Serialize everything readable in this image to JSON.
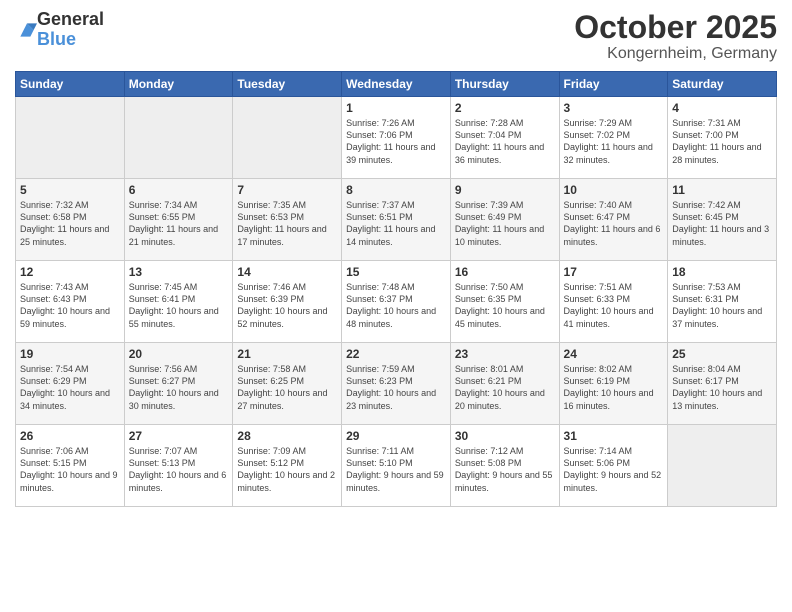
{
  "header": {
    "logo_general": "General",
    "logo_blue": "Blue",
    "month_title": "October 2025",
    "location": "Kongernheim, Germany"
  },
  "weekdays": [
    "Sunday",
    "Monday",
    "Tuesday",
    "Wednesday",
    "Thursday",
    "Friday",
    "Saturday"
  ],
  "rows": [
    [
      {
        "day": "",
        "empty": true
      },
      {
        "day": "",
        "empty": true
      },
      {
        "day": "",
        "empty": true
      },
      {
        "day": "1",
        "sunrise": "7:26 AM",
        "sunset": "7:06 PM",
        "daylight": "11 hours and 39 minutes."
      },
      {
        "day": "2",
        "sunrise": "7:28 AM",
        "sunset": "7:04 PM",
        "daylight": "11 hours and 36 minutes."
      },
      {
        "day": "3",
        "sunrise": "7:29 AM",
        "sunset": "7:02 PM",
        "daylight": "11 hours and 32 minutes."
      },
      {
        "day": "4",
        "sunrise": "7:31 AM",
        "sunset": "7:00 PM",
        "daylight": "11 hours and 28 minutes."
      }
    ],
    [
      {
        "day": "5",
        "sunrise": "7:32 AM",
        "sunset": "6:58 PM",
        "daylight": "11 hours and 25 minutes."
      },
      {
        "day": "6",
        "sunrise": "7:34 AM",
        "sunset": "6:55 PM",
        "daylight": "11 hours and 21 minutes."
      },
      {
        "day": "7",
        "sunrise": "7:35 AM",
        "sunset": "6:53 PM",
        "daylight": "11 hours and 17 minutes."
      },
      {
        "day": "8",
        "sunrise": "7:37 AM",
        "sunset": "6:51 PM",
        "daylight": "11 hours and 14 minutes."
      },
      {
        "day": "9",
        "sunrise": "7:39 AM",
        "sunset": "6:49 PM",
        "daylight": "11 hours and 10 minutes."
      },
      {
        "day": "10",
        "sunrise": "7:40 AM",
        "sunset": "6:47 PM",
        "daylight": "11 hours and 6 minutes."
      },
      {
        "day": "11",
        "sunrise": "7:42 AM",
        "sunset": "6:45 PM",
        "daylight": "11 hours and 3 minutes."
      }
    ],
    [
      {
        "day": "12",
        "sunrise": "7:43 AM",
        "sunset": "6:43 PM",
        "daylight": "10 hours and 59 minutes."
      },
      {
        "day": "13",
        "sunrise": "7:45 AM",
        "sunset": "6:41 PM",
        "daylight": "10 hours and 55 minutes."
      },
      {
        "day": "14",
        "sunrise": "7:46 AM",
        "sunset": "6:39 PM",
        "daylight": "10 hours and 52 minutes."
      },
      {
        "day": "15",
        "sunrise": "7:48 AM",
        "sunset": "6:37 PM",
        "daylight": "10 hours and 48 minutes."
      },
      {
        "day": "16",
        "sunrise": "7:50 AM",
        "sunset": "6:35 PM",
        "daylight": "10 hours and 45 minutes."
      },
      {
        "day": "17",
        "sunrise": "7:51 AM",
        "sunset": "6:33 PM",
        "daylight": "10 hours and 41 minutes."
      },
      {
        "day": "18",
        "sunrise": "7:53 AM",
        "sunset": "6:31 PM",
        "daylight": "10 hours and 37 minutes."
      }
    ],
    [
      {
        "day": "19",
        "sunrise": "7:54 AM",
        "sunset": "6:29 PM",
        "daylight": "10 hours and 34 minutes."
      },
      {
        "day": "20",
        "sunrise": "7:56 AM",
        "sunset": "6:27 PM",
        "daylight": "10 hours and 30 minutes."
      },
      {
        "day": "21",
        "sunrise": "7:58 AM",
        "sunset": "6:25 PM",
        "daylight": "10 hours and 27 minutes."
      },
      {
        "day": "22",
        "sunrise": "7:59 AM",
        "sunset": "6:23 PM",
        "daylight": "10 hours and 23 minutes."
      },
      {
        "day": "23",
        "sunrise": "8:01 AM",
        "sunset": "6:21 PM",
        "daylight": "10 hours and 20 minutes."
      },
      {
        "day": "24",
        "sunrise": "8:02 AM",
        "sunset": "6:19 PM",
        "daylight": "10 hours and 16 minutes."
      },
      {
        "day": "25",
        "sunrise": "8:04 AM",
        "sunset": "6:17 PM",
        "daylight": "10 hours and 13 minutes."
      }
    ],
    [
      {
        "day": "26",
        "sunrise": "7:06 AM",
        "sunset": "5:15 PM",
        "daylight": "10 hours and 9 minutes."
      },
      {
        "day": "27",
        "sunrise": "7:07 AM",
        "sunset": "5:13 PM",
        "daylight": "10 hours and 6 minutes."
      },
      {
        "day": "28",
        "sunrise": "7:09 AM",
        "sunset": "5:12 PM",
        "daylight": "10 hours and 2 minutes."
      },
      {
        "day": "29",
        "sunrise": "7:11 AM",
        "sunset": "5:10 PM",
        "daylight": "9 hours and 59 minutes."
      },
      {
        "day": "30",
        "sunrise": "7:12 AM",
        "sunset": "5:08 PM",
        "daylight": "9 hours and 55 minutes."
      },
      {
        "day": "31",
        "sunrise": "7:14 AM",
        "sunset": "5:06 PM",
        "daylight": "9 hours and 52 minutes."
      },
      {
        "day": "",
        "empty": true
      }
    ]
  ],
  "labels": {
    "sunrise": "Sunrise:",
    "sunset": "Sunset:",
    "daylight": "Daylight:"
  }
}
